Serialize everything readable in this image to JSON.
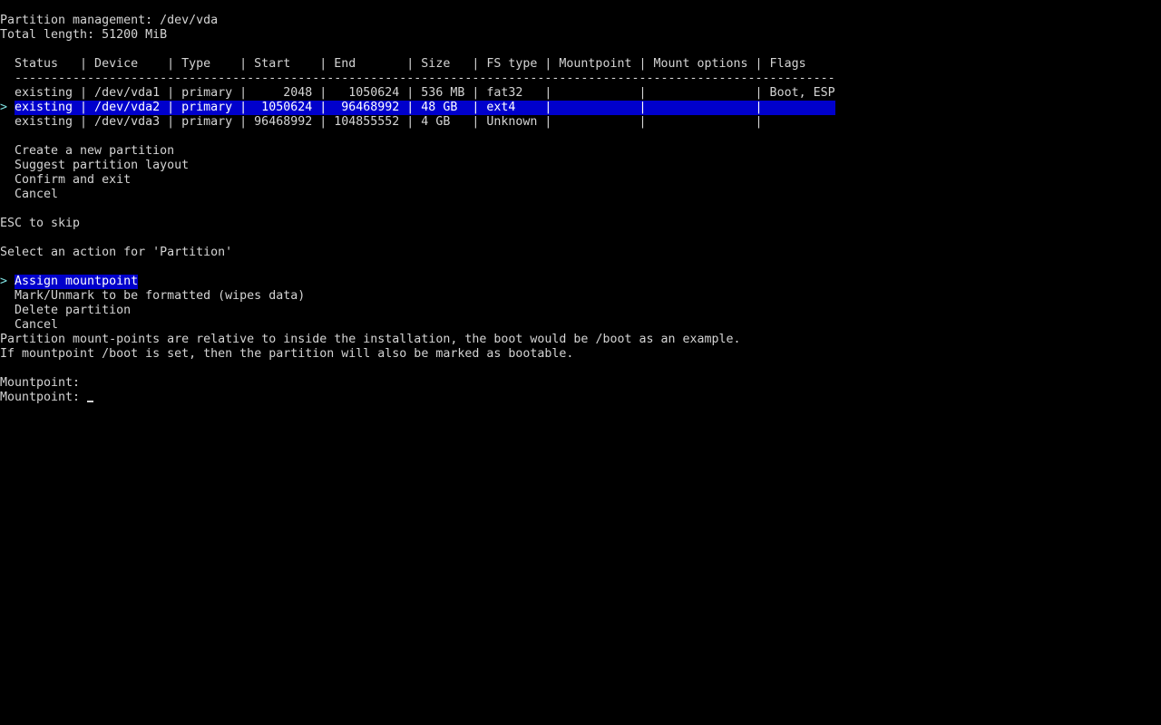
{
  "header": {
    "title": "Partition management: /dev/vda",
    "total": "Total length: 51200 MiB"
  },
  "table": {
    "header": "Status   | Device    | Type    | Start    | End       | Size   | FS type | Mountpoint | Mount options | Flags",
    "separator": "-----------------------------------------------------------------------------------------------------------------",
    "pointer": ">",
    "rows": [
      {
        "text": "existing | /dev/vda1 | primary |     2048 |   1050624 | 536 MB | fat32   |            |               | Boot, ESP",
        "selected": false
      },
      {
        "text": "existing | /dev/vda2 | primary |  1050624 |  96468992 | 48 GB  | ext4    |            |               |          ",
        "selected": true
      },
      {
        "text": "existing | /dev/vda3 | primary | 96468992 | 104855552 | 4 GB   | Unknown |            |               |",
        "selected": false
      }
    ]
  },
  "main_menu": {
    "items": [
      "Create a new partition",
      "Suggest partition layout",
      "Confirm and exit",
      "Cancel"
    ]
  },
  "hint": "ESC to skip",
  "action_prompt": "Select an action for 'Partition'",
  "action_menu": {
    "pointer": ">",
    "items": [
      {
        "label": "Assign mountpoint",
        "selected": true
      },
      {
        "label": "Mark/Unmark to be formatted (wipes data)",
        "selected": false
      },
      {
        "label": "Delete partition",
        "selected": false
      },
      {
        "label": "Cancel",
        "selected": false
      }
    ]
  },
  "info": {
    "line1": "Partition mount-points are relative to inside the installation, the boot would be /boot as an example.",
    "line2": "If mountpoint /boot is set, then the partition will also be marked as bootable."
  },
  "mountpoint": {
    "label1": "Mountpoint:",
    "label2": "Mountpoint: ",
    "value": ""
  },
  "colors": {
    "background": "#000000",
    "text": "#d4d4d4",
    "highlight": "#0000cc",
    "pointer": "#7fe0e0"
  }
}
